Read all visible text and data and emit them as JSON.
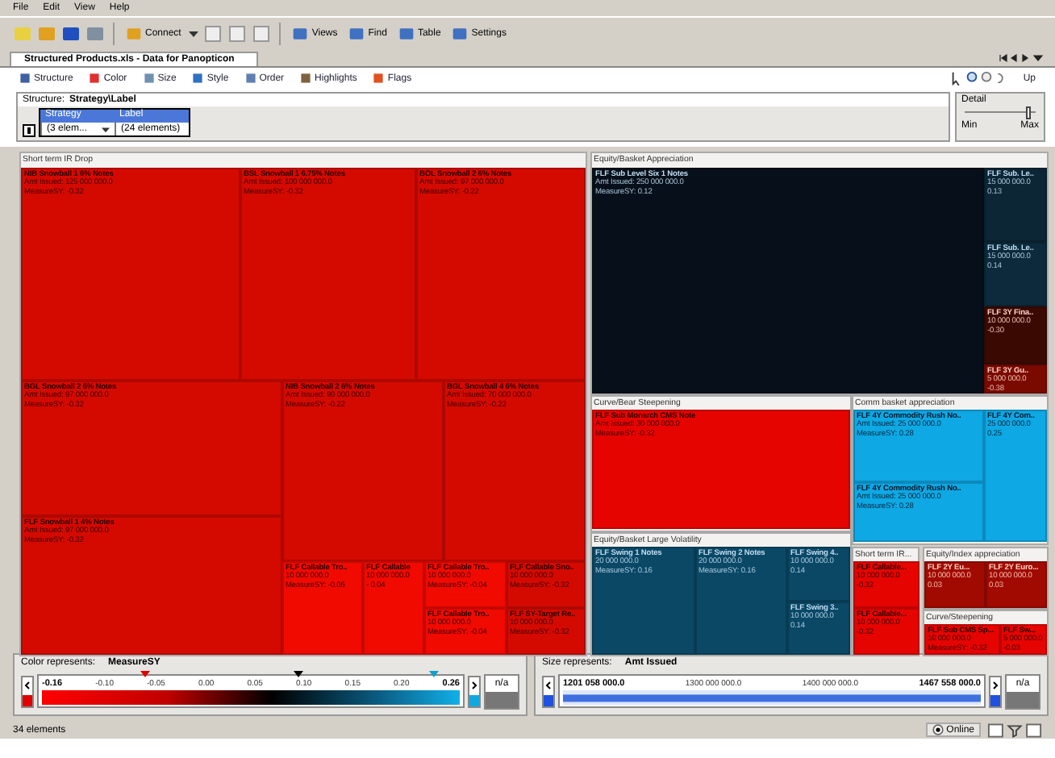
{
  "menu": [
    "File",
    "Edit",
    "View",
    "Help"
  ],
  "toolbar": [
    {
      "label": "Connect"
    },
    {
      "label": "Views"
    },
    {
      "label": "Find"
    },
    {
      "label": "Table"
    },
    {
      "label": "Settings"
    }
  ],
  "document_tab": {
    "title": "Structured Products.xls - Data for Panopticon",
    "selected": true
  },
  "view_toolbar": [
    "Structure",
    "Color",
    "Size",
    "Style",
    "Order",
    "Highlights",
    "Flags"
  ],
  "view_tools": {
    "up": "Up"
  },
  "structure": {
    "label": "Structure:",
    "value": "Strategy\\Label",
    "columns": [
      {
        "header": "Strategy",
        "value": "(3 elem...",
        "dropdown": true
      },
      {
        "header": "Label",
        "value": "(24 elements)",
        "dropdown": false
      }
    ]
  },
  "detail": {
    "title": "Detail",
    "level": 0.92,
    "min": "Min",
    "max": "Max"
  },
  "treemap": {
    "groups": [
      {
        "title": "Short term IR Drop",
        "cells": [
          {
            "name": "NIB Snowball 1 6% Notes",
            "amount": "Amt Issued: 125 000 000.0",
            "measure": "MeasureSY: -0.32",
            "color": "#d40a00"
          },
          {
            "name": "BSL Snowball 1 6.75% Notes",
            "amount": "Amt Issued: 100 000 000.0",
            "measure": "MeasureSY: -0.32",
            "color": "#d40a00"
          },
          {
            "name": "BOL Snowball 2 6% Notes",
            "amount": "Amt Issued: 97 000 000.0",
            "measure": "MeasureSY: -0.22",
            "color": "#d40a00"
          },
          {
            "name": "BGL Snowball 2 6% Notes",
            "amount": "Amt Issued: 97 000 000.0",
            "measure": "MeasureSY: -0.32",
            "color": "#d40a00"
          },
          {
            "name": "FLF Snowball 1 4% Notes",
            "amount": "Amt Issued: 97 000 000.0",
            "measure": "MeasureSY: -0.32",
            "color": "#d40a00"
          },
          {
            "name": "NIB Snowball 2 6% Notes",
            "amount": "Amt Issued: 90 000 000.0",
            "measure": "MeasureSY: -0.22",
            "color": "#d40a00"
          },
          {
            "name": "BGL Snowball 4 6% Notes",
            "amount": "Amt Issued: 70 000 000.0",
            "measure": "MeasureSY: -0.22",
            "color": "#d40a00"
          },
          {
            "name": "FLF Callable Tro..",
            "amount": "10 000 000.0",
            "measure": "MeasureSY: -0.06",
            "color": "#f00a00"
          },
          {
            "name": "FLF Callable",
            "amount": "10 000 000.0",
            "measure": "- 0.04",
            "color": "#f00a00"
          },
          {
            "name": "FLF Callable Tro..",
            "amount": "10 000 000.0",
            "measure": "MeasureSY: -0.04",
            "color": "#f00a00"
          },
          {
            "name": "FLF Callable Tro..",
            "amount": "10 000 000.0",
            "measure": "MeasureSY: -0.04",
            "color": "#f00a00"
          },
          {
            "name": "FLF Callable Sno..",
            "amount": "10 000 000.0",
            "measure": "MeasureSY: -0.32",
            "color": "#d40a00"
          },
          {
            "name": "FLF SY-Target Re..",
            "amount": "10 000 000.0",
            "measure": "MeasureSY: -0.32",
            "color": "#d40a00"
          }
        ]
      },
      {
        "title": "Equity/Basket Appreciation",
        "cells": [
          {
            "name": "FLF Sub Level Six 1 Notes",
            "amount": "Amt Issued: 250 000 000.0",
            "measure": "MeasureSY: 0.12",
            "color": "#07101a"
          },
          {
            "name": "FLF Sub. Le..",
            "amount": "15 000 000.0",
            "measure": "0.13",
            "color": "#0c2636"
          },
          {
            "name": "FLF Sub. Le..",
            "amount": "15 000 000.0",
            "measure": "0.14",
            "color": "#0c2a3c"
          },
          {
            "name": "FLF 3Y Fina..",
            "amount": "10 000 000.0",
            "measure": "-0.30",
            "color": "#3a0a02"
          },
          {
            "name": "FLF 3Y Gu..",
            "amount": "5 000 000.0",
            "measure": "-0.38",
            "color": "#7a0a00"
          }
        ]
      },
      {
        "title": "Curve/Bear Steepening",
        "cells": [
          {
            "name": "FLF Sub Monarch CMS Note",
            "amount": "Amt Issued: 30 000 000.0",
            "measure": "MeasureSY: -0.32",
            "color": "#e60400"
          }
        ]
      },
      {
        "title": "Comm basket appreciation",
        "cells": [
          {
            "name": "FLF 4Y Commodity Rush No..",
            "amount": "Amt Issued: 25 000 000.0",
            "measure": "MeasureSY: 0.28",
            "color": "#0ea8e4"
          },
          {
            "name": "FLF 4Y Com..",
            "amount": "25 000 000.0",
            "measure": "0.25",
            "color": "#0ea8e4"
          },
          {
            "name": "FLF 4Y Commodity Rush No..",
            "amount": "Amt Issued: 25 000 000.0",
            "measure": "MeasureSY: 0.28",
            "color": "#0ea8e4"
          }
        ]
      },
      {
        "title": "Equity/Basket Large Volatility",
        "cells": [
          {
            "name": "FLF Swing 1 Notes",
            "amount": "20 000 000.0",
            "measure": "MeasureSY: 0.16",
            "color": "#0a4866"
          },
          {
            "name": "FLF Swing 2 Notes",
            "amount": "20 000 000.0",
            "measure": "MeasureSY: 0.16",
            "color": "#0a4866"
          },
          {
            "name": "FLF Swing 4..",
            "amount": "10 000 000.0",
            "measure": "0.14",
            "color": "#0a4866"
          },
          {
            "name": "FLF Swing 3..",
            "amount": "10 000 000.0",
            "measure": "0.14",
            "color": "#0a4866"
          }
        ]
      },
      {
        "title": "Short term IR...",
        "cells": [
          {
            "name": "FLF Callable...",
            "amount": "10 000 000.0",
            "measure": "-0.32",
            "color": "#e60400"
          },
          {
            "name": "FLF Callable...",
            "amount": "10 000 000.0",
            "measure": "-0.32",
            "color": "#e60400"
          }
        ]
      },
      {
        "title": "Equity/Index appreciation",
        "cells": [
          {
            "name": "FLF 2Y Eu...",
            "amount": "10 000 000.0",
            "measure": "0.03",
            "color": "#a00a00"
          },
          {
            "name": "FLF 2Y Euro...",
            "amount": "10 000 000.0",
            "measure": "0.03",
            "color": "#a00a00"
          }
        ]
      },
      {
        "title": "Curve/Steepening",
        "cells": [
          {
            "name": "FLF Sub CMS Sp...",
            "amount": "10 000 000.0",
            "measure": "MeasureSY: -0.32",
            "color": "#e60400"
          },
          {
            "name": "FLF Sw...",
            "amount": "5 000 000.0",
            "measure": "-0.03",
            "color": "#e60400"
          }
        ]
      }
    ]
  },
  "color_legend": {
    "label": "Color represents:",
    "field": "MeasureSY",
    "ticks": [
      "-0.16",
      "-0.10",
      "-0.05",
      "0.00",
      "0.05",
      "0.10",
      "0.15",
      "0.20",
      "0.26"
    ],
    "na": "n/a"
  },
  "size_legend": {
    "label": "Size represents:",
    "field": "Amt Issued",
    "ticks": [
      "1201 058 000.0",
      "1300 000 000.0",
      "1400 000 000.0",
      "1467 558 000.0"
    ],
    "na": "n/a"
  },
  "status_bar": {
    "count": "34 elements",
    "mode": "Online"
  }
}
